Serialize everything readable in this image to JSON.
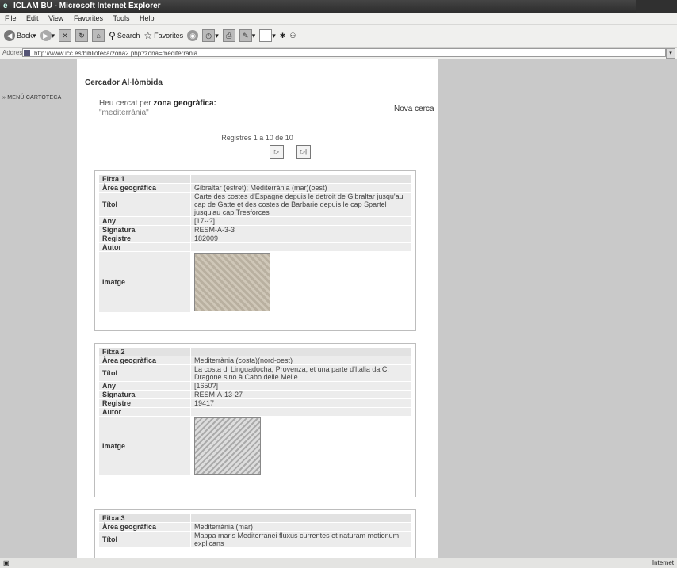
{
  "window": {
    "title": "ICLAM BU - Microsoft Internet Explorer"
  },
  "menu": [
    "File",
    "Edit",
    "View",
    "Favorites",
    "Tools",
    "Help"
  ],
  "toolbar": {
    "back": "Back",
    "search": "Search",
    "favorites": "Favorites"
  },
  "address": {
    "label": "Address",
    "url": "http://www.icc.es/biblioteca/zona2.php?zona=mediterrània"
  },
  "sidebar": {
    "menu_link": "» MENÚ CARTOTECA"
  },
  "page": {
    "header": "Cercador Al·lòmbida",
    "search_prefix": "Heu cercat per ",
    "search_field": "zona geogràfica",
    "search_term": "\"mediterrània\"",
    "new_search": "Nova cerca",
    "records_info": "Registres 1 a 10 de 10"
  },
  "pager": {
    "next": "▷",
    "last": "▷|"
  },
  "records": [
    {
      "header": "Fitxa 1",
      "rows": [
        {
          "k": "Àrea geogràfica",
          "v": "Gibraltar (estret); Mediterrània (mar)(oest)"
        },
        {
          "k": "Títol",
          "v": "Carte des costes d'Espagne depuis le detroit de Gibraltar jusqu'au cap de Gatte et des costes de Barbarie depuis le cap Spartel jusqu'au cap Tresforces"
        },
        {
          "k": "Any",
          "v": "[17--?]"
        },
        {
          "k": "Signatura",
          "v": "RESM-A-3-3"
        },
        {
          "k": "Registre",
          "v": "182009"
        },
        {
          "k": "Autor",
          "v": ""
        }
      ],
      "image_label": "Imatge"
    },
    {
      "header": "Fitxa 2",
      "rows": [
        {
          "k": "Àrea geogràfica",
          "v": "Mediterrània (costa)(nord-oest)"
        },
        {
          "k": "Títol",
          "v": "La costa di Linguadocha, Provenza, et una parte d'Italia da C. Dragone sino à Cabo delle Melle"
        },
        {
          "k": "Any",
          "v": "[1650?]"
        },
        {
          "k": "Signatura",
          "v": "RESM-A-13-27"
        },
        {
          "k": "Registre",
          "v": "19417"
        },
        {
          "k": "Autor",
          "v": ""
        }
      ],
      "image_label": "Imatge"
    },
    {
      "header": "Fitxa 3",
      "rows": [
        {
          "k": "Àrea geogràfica",
          "v": "Mediterrània (mar)"
        },
        {
          "k": "Títol",
          "v": "Mappa maris Mediterranei fluxus currentes et naturam motionum explicans"
        }
      ]
    }
  ],
  "status": {
    "right": "Internet"
  }
}
